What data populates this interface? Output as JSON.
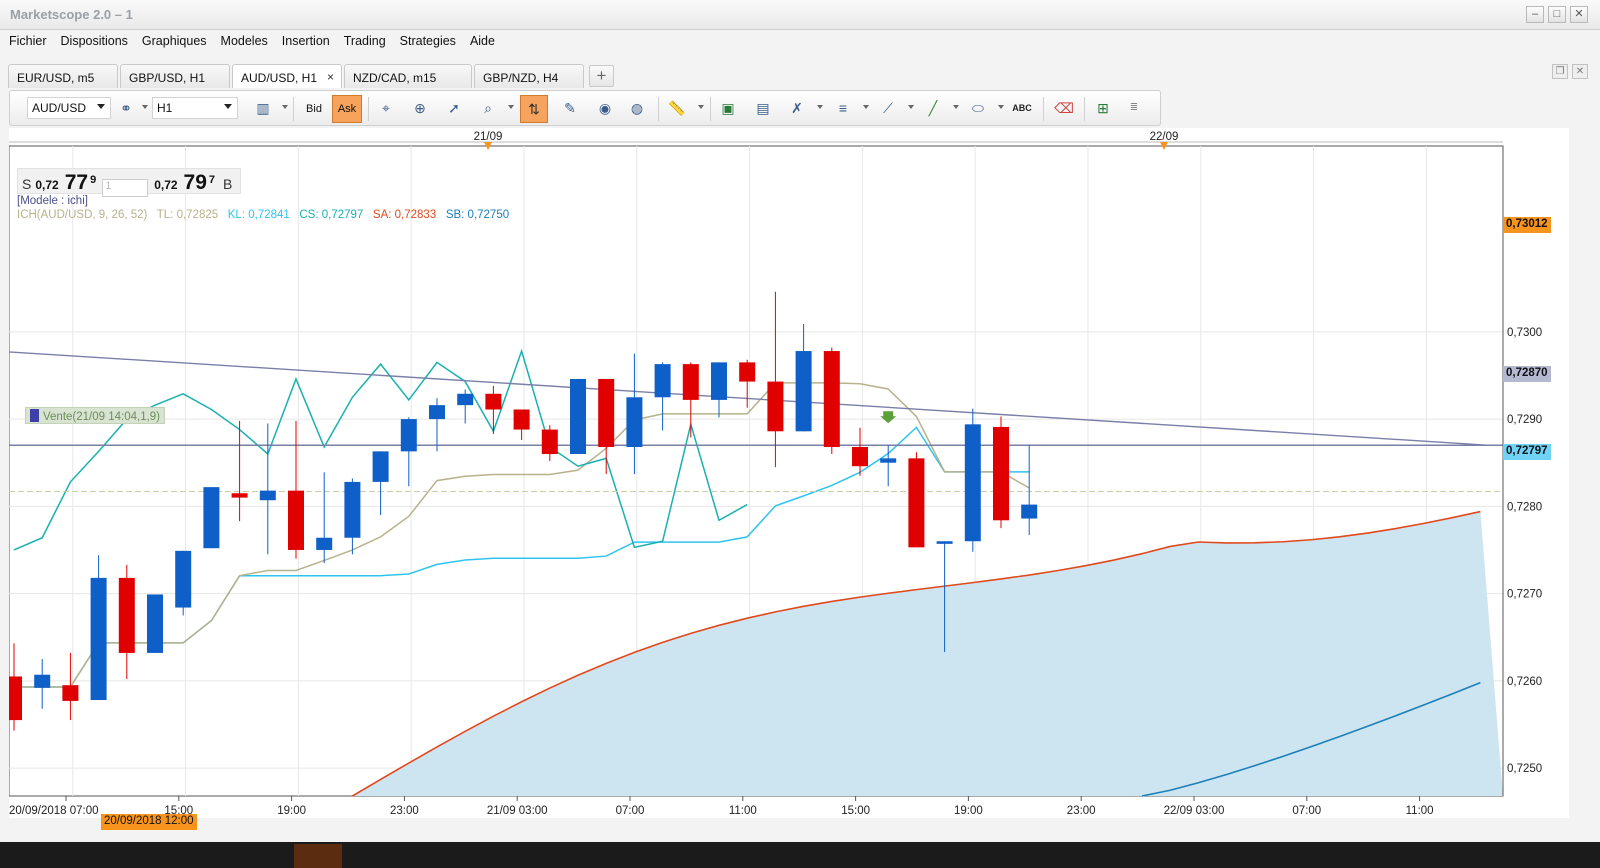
{
  "window": {
    "title": "Marketscope 2.0 – 1"
  },
  "menu": [
    "Fichier",
    "Dispositions",
    "Graphiques",
    "Modeles",
    "Insertion",
    "Trading",
    "Strategies",
    "Aide"
  ],
  "tabs": [
    {
      "label": "EUR/USD, m5",
      "active": false
    },
    {
      "label": "GBP/USD, H1",
      "active": false
    },
    {
      "label": "AUD/USD, H1",
      "active": true,
      "close": "×"
    },
    {
      "label": "NZD/CAD, m15",
      "active": false
    },
    {
      "label": "GBP/NZD, H4",
      "active": false
    }
  ],
  "tab_add": "+",
  "toolbar": {
    "symbol": "AUD/USD",
    "timeframe": "H1",
    "bid_label": "Bid",
    "ask_label": "Ask"
  },
  "quote": {
    "sell_label": "S",
    "sell_prefix": "0,72",
    "sell_big": "77",
    "sell_frac": "9",
    "amount": "1",
    "buy_prefix": "0,72",
    "buy_big": "79",
    "buy_frac": "7",
    "buy_label": "B"
  },
  "modele_text": "[Modele : ichi]",
  "ichimoku_legend": {
    "name": "ICH(AUD/USD, 9, 26, 52)",
    "tl": "TL: 0,72825",
    "kl": "KL: 0,72841",
    "cs": "CS: 0,72797",
    "sa": "SA: 0,72833",
    "sb": "SB: 0,72750",
    "colors": {
      "ich": "#b6b28a",
      "tl": "#b6b28a",
      "kl": "#2ec4f1",
      "cs": "#1ab0b0",
      "sa": "#e0491c",
      "sb": "#1d7fb8"
    }
  },
  "vente_label": "Vente(21/09 14:04,1,9)",
  "price_badges": [
    {
      "label": "0,73012",
      "price": 0.73012,
      "color": "#f7941d"
    },
    {
      "label": "0,72870",
      "price": 0.7287,
      "color": "#b4b8d0"
    },
    {
      "label": "0,72797",
      "price": 0.72797,
      "color": "#6fd3f7"
    }
  ],
  "x_axis_bottom": [
    "20/09/2018 07:00",
    "15:00",
    "19:00",
    "23:00",
    "21/09 03:00",
    "07:00",
    "11:00",
    "15:00",
    "19:00",
    "23:00",
    "22/09 03:00",
    "07:00",
    "11:00"
  ],
  "x_axis_highlight": "20/09/2018 12:00",
  "x_axis_top": [
    "21/09",
    "22/09"
  ],
  "chart_data": {
    "type": "candlestick",
    "symbol": "AUD/USD",
    "timeframe": "H1",
    "y_ticks": [
      0.725,
      0.726,
      0.727,
      0.728,
      0.729,
      0.73
    ],
    "y_tick_labels": [
      "0,7250",
      "0,7260",
      "0,7270",
      "0,7280",
      "0,7290",
      "0,7300"
    ],
    "ylim": [
      0.72468,
      0.73213
    ],
    "candles_ohlc": [
      [
        0.72605,
        0.72643,
        0.72543,
        0.72555
      ],
      [
        0.72592,
        0.72625,
        0.72568,
        0.72607
      ],
      [
        0.72595,
        0.72632,
        0.72555,
        0.72577
      ],
      [
        0.72578,
        0.72744,
        0.72578,
        0.72718
      ],
      [
        0.72718,
        0.72733,
        0.72602,
        0.72632
      ],
      [
        0.72632,
        0.72697,
        0.72632,
        0.72699
      ],
      [
        0.72684,
        0.72732,
        0.72675,
        0.72749
      ],
      [
        0.72752,
        0.72795,
        0.72752,
        0.72822
      ],
      [
        0.72815,
        0.72898,
        0.72783,
        0.7281
      ],
      [
        0.72807,
        0.72895,
        0.72745,
        0.72818
      ],
      [
        0.72818,
        0.72898,
        0.7274,
        0.7275
      ],
      [
        0.7275,
        0.72839,
        0.72735,
        0.72764
      ],
      [
        0.72764,
        0.72832,
        0.72745,
        0.72828
      ],
      [
        0.72828,
        0.72852,
        0.7279,
        0.72863
      ],
      [
        0.72863,
        0.72902,
        0.72823,
        0.729
      ],
      [
        0.729,
        0.72924,
        0.72863,
        0.72916
      ],
      [
        0.72916,
        0.72934,
        0.72895,
        0.72929
      ],
      [
        0.72929,
        0.72938,
        0.72883,
        0.72911
      ],
      [
        0.72911,
        0.72908,
        0.72876,
        0.72888
      ],
      [
        0.72888,
        0.72893,
        0.72852,
        0.7286
      ],
      [
        0.7286,
        0.72938,
        0.7286,
        0.72946
      ],
      [
        0.72946,
        0.72943,
        0.72837,
        0.72868
      ],
      [
        0.72868,
        0.72975,
        0.72837,
        0.72925
      ],
      [
        0.72925,
        0.72965,
        0.72887,
        0.72963
      ],
      [
        0.72963,
        0.72965,
        0.72879,
        0.72922
      ],
      [
        0.72922,
        0.72962,
        0.72902,
        0.72965
      ],
      [
        0.72965,
        0.72968,
        0.72913,
        0.72943
      ],
      [
        0.72943,
        0.73046,
        0.72845,
        0.72886
      ],
      [
        0.72886,
        0.73009,
        0.72886,
        0.72978
      ],
      [
        0.72978,
        0.72982,
        0.7286,
        0.72868
      ],
      [
        0.72868,
        0.7289,
        0.72835,
        0.72846
      ],
      [
        0.7285,
        0.7287,
        0.72823,
        0.72855
      ],
      [
        0.72855,
        0.72862,
        0.7276,
        0.72753
      ],
      [
        0.72757,
        0.72752,
        0.72633,
        0.7276
      ],
      [
        0.7276,
        0.72912,
        0.72748,
        0.72894
      ],
      [
        0.72891,
        0.72903,
        0.72775,
        0.72784
      ],
      [
        0.72786,
        0.7287,
        0.72767,
        0.72802
      ]
    ],
    "bullish_color": "#0f5fc8",
    "bearish_color": "#e00000",
    "horizontal_line_price": 0.7287,
    "hline_dashed": 0.72817,
    "resistance_line": {
      "start": 0.72977,
      "end": 0.7287
    }
  }
}
